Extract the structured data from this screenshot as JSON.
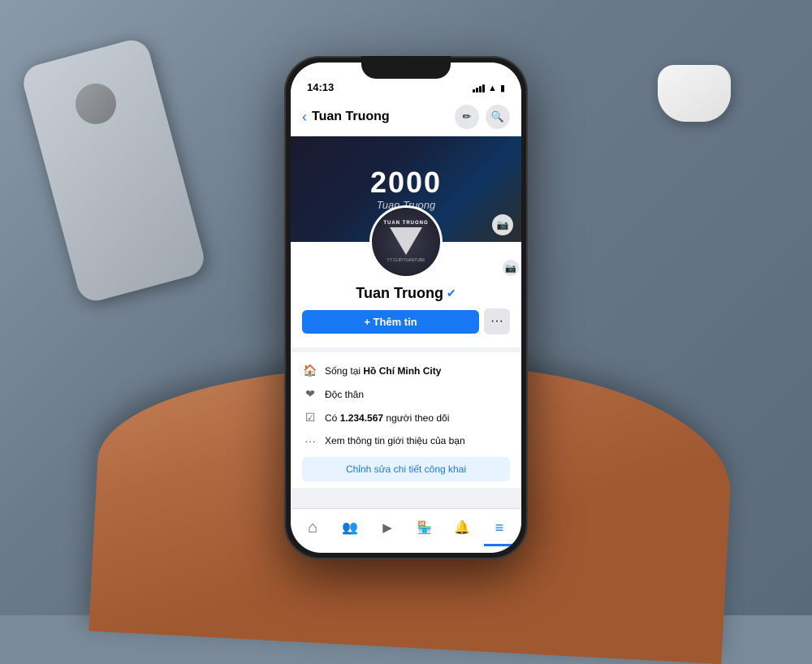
{
  "scene": {
    "background": "#7a8a9a"
  },
  "status_bar": {
    "time": "14:13"
  },
  "header": {
    "back_label": "‹",
    "title": "Tuan Truong",
    "edit_icon": "✏",
    "search_icon": "🔍"
  },
  "cover": {
    "title_number": "2000",
    "title_name": "Tuan Truong"
  },
  "profile": {
    "name": "Tuan Truong",
    "verified": true,
    "avatar_text_line1": "TUAN TRUONG",
    "avatar_text_line2": "YT CLIP/TUANTUBE"
  },
  "actions": {
    "add_info_label": "+ Thêm tin",
    "more_label": "···"
  },
  "info_items": [
    {
      "icon": "🏠",
      "text": "Sống tại ",
      "bold": "Hồ Chí Minh City"
    },
    {
      "icon": "❤",
      "text": "Độc thân",
      "bold": ""
    },
    {
      "icon": "☑",
      "text": "Có ",
      "bold": "1.234.567",
      "text2": " người theo dõi"
    },
    {
      "icon": "···",
      "text": "Xem thông tin giới thiệu của bạn",
      "bold": ""
    }
  ],
  "edit_button_label": "Chỉnh sửa chi tiết công khai",
  "bottom_nav": {
    "items": [
      {
        "icon": "⌂",
        "label": "home",
        "active": false
      },
      {
        "icon": "👥",
        "label": "friends",
        "active": false
      },
      {
        "icon": "▶",
        "label": "video",
        "active": false
      },
      {
        "icon": "🏪",
        "label": "marketplace",
        "active": false
      },
      {
        "icon": "🔔",
        "label": "notifications",
        "active": false
      },
      {
        "icon": "≡",
        "label": "menu",
        "active": true
      }
    ]
  }
}
